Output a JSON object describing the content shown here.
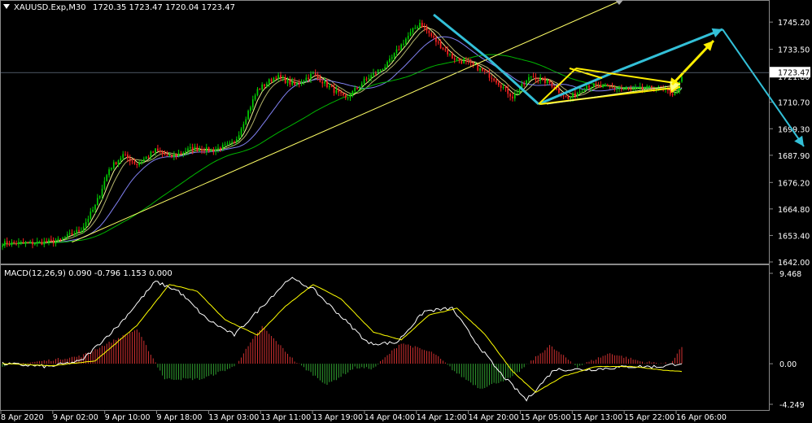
{
  "header": {
    "symbol": "XAUUSD.Exp,M30",
    "ohlc": "1720.35 1723.47 1720.04 1723.47"
  },
  "colors": {
    "background": "#000000",
    "bull_candle": "#00cc00",
    "bear_candle": "#ff2020",
    "ma_fast": "#ffff99",
    "ma_mid": "#8888ff",
    "ma_slow": "#00c000",
    "trendline": "#ffff66",
    "arrow_cyan": "#33c0d8",
    "arrow_yellow": "#ffee00",
    "macd_hist_pos": "#d03030",
    "macd_hist_neg": "#30a030",
    "macd_line": "#ffffff",
    "signal_line": "#ffff00",
    "grid_text": "#ffffff"
  },
  "chart_data": [
    {
      "type": "candlestick",
      "panel": "price",
      "ylim": [
        1642.0,
        1754.0
      ],
      "price_ticks": [
        "1745.20",
        "1733.50",
        "1721.80",
        "1710.70",
        "1699.30",
        "1687.90",
        "1676.20",
        "1664.80",
        "1653.40",
        "1642.00"
      ],
      "current_price": "1723.47",
      "anchors": [
        [
          0,
          1650
        ],
        [
          12,
          1650
        ],
        [
          24,
          1651
        ],
        [
          34,
          1656
        ],
        [
          40,
          1666
        ],
        [
          46,
          1682
        ],
        [
          52,
          1688
        ],
        [
          58,
          1684
        ],
        [
          66,
          1690
        ],
        [
          72,
          1687
        ],
        [
          82,
          1691
        ],
        [
          90,
          1690
        ],
        [
          100,
          1693
        ],
        [
          110,
          1716
        ],
        [
          118,
          1722
        ],
        [
          126,
          1718
        ],
        [
          134,
          1723
        ],
        [
          140,
          1718
        ],
        [
          148,
          1712
        ],
        [
          156,
          1720
        ],
        [
          166,
          1727
        ],
        [
          174,
          1738
        ],
        [
          180,
          1745
        ],
        [
          186,
          1738
        ],
        [
          194,
          1730
        ],
        [
          204,
          1726
        ],
        [
          212,
          1721
        ],
        [
          220,
          1713
        ],
        [
          228,
          1722
        ],
        [
          236,
          1719
        ],
        [
          244,
          1712
        ],
        [
          252,
          1718
        ],
        [
          262,
          1717
        ],
        [
          272,
          1716
        ],
        [
          282,
          1717
        ],
        [
          290,
          1714
        ],
        [
          293,
          1721
        ]
      ],
      "x_labels": [
        "8 Apr 2020",
        "9 Apr 02:00",
        "9 Apr 10:00",
        "9 Apr 18:00",
        "13 Apr 03:00",
        "13 Apr 11:00",
        "13 Apr 19:00",
        "14 Apr 04:00",
        "14 Apr 12:00",
        "14 Apr 20:00",
        "15 Apr 05:00",
        "15 Apr 13:00",
        "15 Apr 22:00",
        "16 Apr 06:00"
      ],
      "indicators": [
        "MA fast (yellow)",
        "MA mid (blue)",
        "MA slow (green)"
      ]
    },
    {
      "type": "macd",
      "panel": "oscillator",
      "label": "MACD(12,26,9) 0.090 -0.796 1.153 0.000",
      "ylim": [
        -4.249,
        9.468
      ],
      "ticks": [
        "9.468",
        "0.00",
        "-4.249"
      ],
      "histogram_anchors": [
        [
          0,
          -0.2
        ],
        [
          18,
          0.3
        ],
        [
          34,
          0.8
        ],
        [
          46,
          2.2
        ],
        [
          58,
          3.6
        ],
        [
          70,
          -1.6
        ],
        [
          86,
          -1.6
        ],
        [
          100,
          -0.3
        ],
        [
          112,
          3.9
        ],
        [
          126,
          0.3
        ],
        [
          140,
          -2.2
        ],
        [
          152,
          -0.4
        ],
        [
          160,
          -0.5
        ],
        [
          172,
          2.2
        ],
        [
          186,
          1.1
        ],
        [
          196,
          -1.0
        ],
        [
          206,
          -2.6
        ],
        [
          220,
          -1.4
        ],
        [
          236,
          1.9
        ],
        [
          248,
          -0.3
        ],
        [
          262,
          1.1
        ],
        [
          276,
          0.2
        ],
        [
          288,
          0.0
        ],
        [
          293,
          1.8
        ]
      ],
      "macd_anchors": [
        [
          0,
          0.0
        ],
        [
          20,
          -0.3
        ],
        [
          34,
          0.3
        ],
        [
          50,
          4.0
        ],
        [
          66,
          8.6
        ],
        [
          76,
          7.6
        ],
        [
          88,
          4.7
        ],
        [
          100,
          3.0
        ],
        [
          112,
          6.0
        ],
        [
          124,
          9.0
        ],
        [
          134,
          7.8
        ],
        [
          148,
          4.5
        ],
        [
          158,
          2.1
        ],
        [
          170,
          2.2
        ],
        [
          182,
          5.5
        ],
        [
          194,
          5.8
        ],
        [
          204,
          2.3
        ],
        [
          214,
          -0.8
        ],
        [
          226,
          -3.8
        ],
        [
          238,
          -0.6
        ],
        [
          254,
          -0.6
        ],
        [
          270,
          -0.3
        ],
        [
          284,
          -0.3
        ],
        [
          293,
          0.09
        ]
      ],
      "signal_anchors": [
        [
          0,
          0.0
        ],
        [
          22,
          -0.2
        ],
        [
          40,
          0.3
        ],
        [
          58,
          4.0
        ],
        [
          72,
          8.3
        ],
        [
          84,
          7.6
        ],
        [
          96,
          4.6
        ],
        [
          110,
          3.0
        ],
        [
          122,
          6.0
        ],
        [
          134,
          8.3
        ],
        [
          146,
          6.8
        ],
        [
          160,
          3.3
        ],
        [
          172,
          2.5
        ],
        [
          184,
          5.1
        ],
        [
          196,
          5.8
        ],
        [
          208,
          3.1
        ],
        [
          220,
          -0.8
        ],
        [
          230,
          -3.0
        ],
        [
          242,
          -1.3
        ],
        [
          256,
          -0.3
        ],
        [
          272,
          -0.3
        ],
        [
          286,
          -0.7
        ],
        [
          293,
          -0.8
        ]
      ]
    }
  ]
}
